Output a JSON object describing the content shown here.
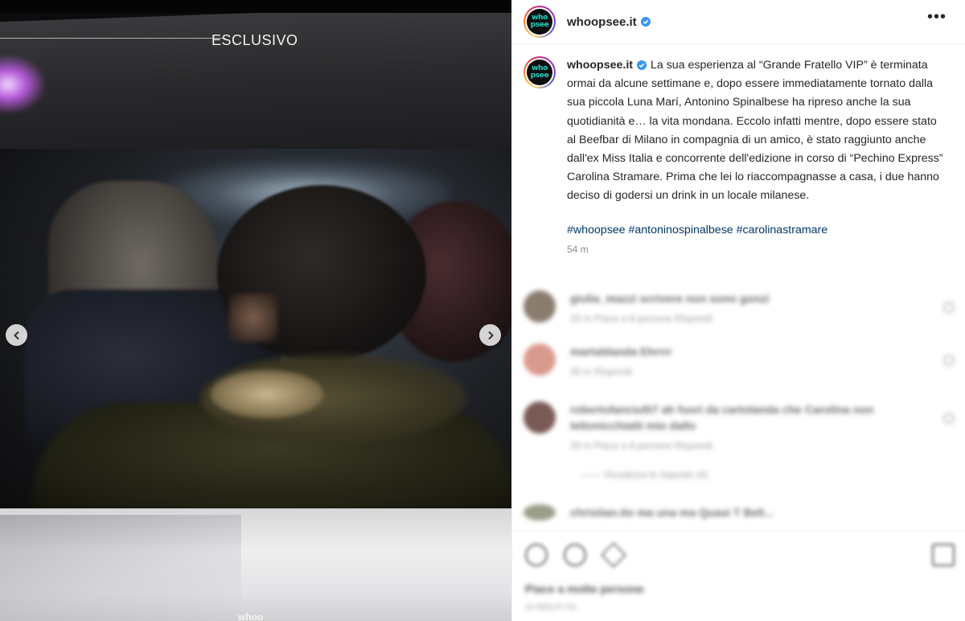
{
  "media": {
    "badge": "ESCLUSIVO",
    "watermark": "whoo",
    "prev_icon": "chevron-left-icon",
    "next_icon": "chevron-right-icon"
  },
  "account": {
    "username": "whoopsee.it",
    "avatar_line1": "who",
    "avatar_line2": "psee",
    "verified_icon": "verified-badge-icon",
    "more_icon": "more-options-icon"
  },
  "caption": {
    "username": "whoopsee.it",
    "text": "La sua esperienza al “Grande Fratello VIP” è terminata ormai da alcune settimane e, dopo essere immediatamente tornato dalla sua piccola Luna Marí, Antonino Spinalbese ha ripreso anche la sua quotidianità e… la vita mondana. Eccolo infatti mentre, dopo essere stato al Beefbar di Milano in compagnia di un amico, è stato raggiunto anche dall'ex Miss Italia e concorrente dell'edizione in corso di “Pechino Express” Carolina Stramare. Prima che lei lo riaccompagnasse a casa, i due hanno deciso di godersi un drink in un locale milanese.",
    "hashtags": "#whoopsee #antoninospinalbese #carolinastramare",
    "time_ago": "54 m"
  },
  "comments": [
    {
      "text": "giulia_mazzi scrivere non sono gonzi",
      "meta": "20 m   Piace a 8 persone   Rispondi",
      "avatar_color": "#8b7c6e"
    },
    {
      "text": "martaldanda Ehrrrr",
      "meta": "30 m   Rispondi",
      "avatar_color": "#d99a8e"
    },
    {
      "text": "robertofanciulli7 ah fuori da cartolanda che Carolina non lettonicchiatti mio dallo",
      "text2": "non lettonicchiatti mio dallo",
      "meta": "20 m   Piace a 8 persone   Rispondi",
      "avatar_color": "#7a5a55"
    },
    {
      "text": "christian.ito ma una ma Quasi T Bell...",
      "meta": "",
      "avatar_color": "#9c9c8a"
    }
  ],
  "view_replies": "——   Visualizza le risposte (4)",
  "likes": "Piace a molte persone",
  "post_date": "10 MINUTI FA"
}
